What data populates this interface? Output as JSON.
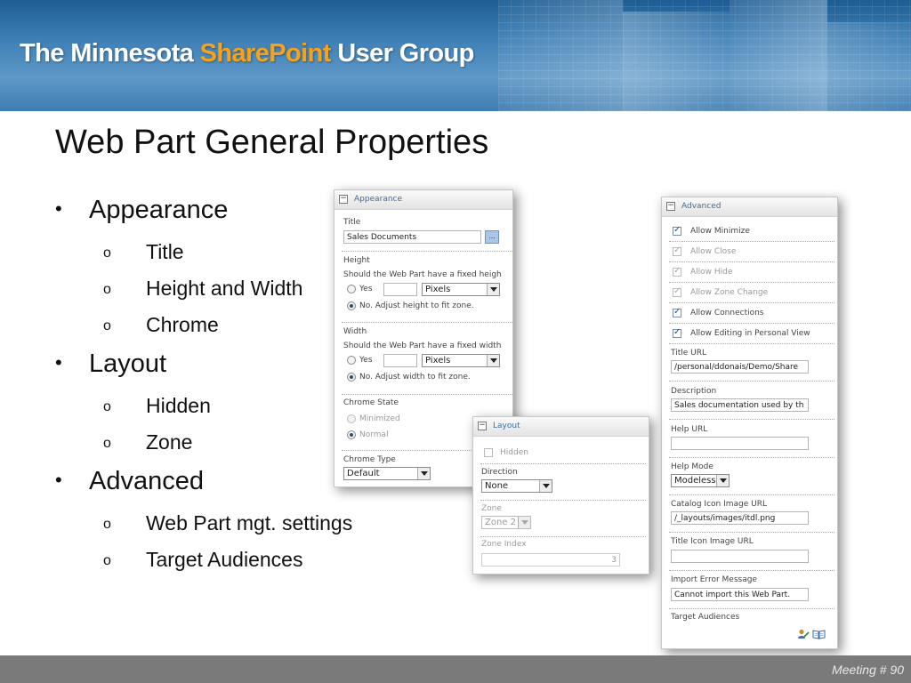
{
  "banner": {
    "title_part1": "The Minnesota ",
    "title_accent": "SharePoint",
    "title_part2": " User Group",
    "accent_color": "#f7a21b"
  },
  "slide": {
    "title": "Web Part General Properties",
    "bullets": [
      {
        "level": 1,
        "mark": "•",
        "text": "Appearance"
      },
      {
        "level": 2,
        "mark": "o",
        "text": "Title"
      },
      {
        "level": 2,
        "mark": "o",
        "text": "Height and Width"
      },
      {
        "level": 2,
        "mark": "o",
        "text": "Chrome"
      },
      {
        "level": 1,
        "mark": "•",
        "text": "Layout"
      },
      {
        "level": 2,
        "mark": "o",
        "text": "Hidden"
      },
      {
        "level": 2,
        "mark": "o",
        "text": "Zone"
      },
      {
        "level": 1,
        "mark": "•",
        "text": "Advanced"
      },
      {
        "level": 2,
        "mark": "o",
        "text": "Web Part mgt. settings"
      },
      {
        "level": 2,
        "mark": "o",
        "text": "Target Audiences"
      }
    ]
  },
  "appearance": {
    "toggle": "−",
    "header": "Appearance",
    "title_label": "Title",
    "title_value": "Sales Documents",
    "browse_label": "...",
    "height_label": "Height",
    "height_question": "Should the Web Part have a fixed heigh",
    "height_yes": "Yes",
    "height_unit": "Pixels",
    "height_no": "No. Adjust height to fit zone.",
    "width_label": "Width",
    "width_question": "Should the Web Part have a fixed width",
    "width_yes": "Yes",
    "width_unit": "Pixels",
    "width_no": "No. Adjust width to fit zone.",
    "chrome_state_label": "Chrome State",
    "chrome_minimized": "Minimized",
    "chrome_normal": "Normal",
    "chrome_type_label": "Chrome Type",
    "chrome_type_value": "Default"
  },
  "layout": {
    "toggle": "−",
    "header": "Layout",
    "hidden_label": "Hidden",
    "direction_label": "Direction",
    "direction_value": "None",
    "zone_label": "Zone",
    "zone_value": "Zone 2",
    "zone_index_label": "Zone Index",
    "zone_index_value": "3"
  },
  "advanced": {
    "toggle": "−",
    "header": "Advanced",
    "checks": [
      {
        "label": "Allow Minimize",
        "checked": true,
        "disabled": false
      },
      {
        "label": "Allow Close",
        "checked": true,
        "disabled": true
      },
      {
        "label": "Allow Hide",
        "checked": true,
        "disabled": true
      },
      {
        "label": "Allow Zone Change",
        "checked": true,
        "disabled": true
      },
      {
        "label": "Allow Connections",
        "checked": true,
        "disabled": false
      },
      {
        "label": "Allow Editing in Personal View",
        "checked": true,
        "disabled": false
      }
    ],
    "title_url_label": "Title URL",
    "title_url_value": "/personal/ddonais/Demo/Share",
    "description_label": "Description",
    "description_value": "Sales documentation used by th",
    "help_url_label": "Help URL",
    "help_url_value": "",
    "help_mode_label": "Help Mode",
    "help_mode_value": "Modeless",
    "catalog_icon_label": "Catalog Icon Image URL",
    "catalog_icon_value": "/_layouts/images/itdl.png",
    "title_icon_label": "Title Icon Image URL",
    "title_icon_value": "",
    "import_error_label": "Import Error Message",
    "import_error_value": "Cannot import this Web Part.",
    "target_audiences_label": "Target Audiences",
    "icons": [
      "people-picker-icon",
      "browse-book-icon"
    ]
  },
  "footer": {
    "meeting": "Meeting # 90"
  }
}
